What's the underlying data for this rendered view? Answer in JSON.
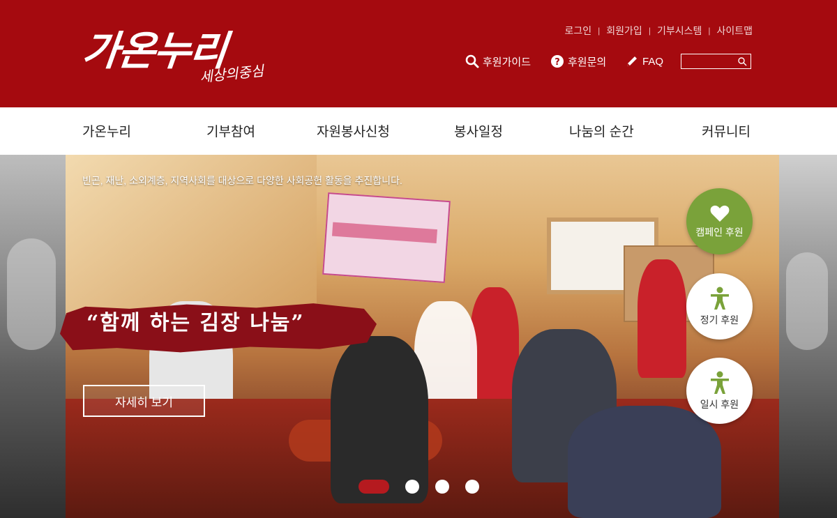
{
  "colors": {
    "header_bg": "#a50a0f",
    "accent_green": "#7aa23a",
    "dot_active": "#b51a1f"
  },
  "logo": {
    "main": "가온누리",
    "sub": "세상의중심"
  },
  "util_links": [
    "로그인",
    "회원가입",
    "기부시스템",
    "사이트맵"
  ],
  "quick_links": [
    {
      "label": "후원가이드",
      "icon": "search-icon"
    },
    {
      "label": "후원문의",
      "icon": "question-circle-icon"
    },
    {
      "label": "FAQ",
      "icon": "pencil-icon"
    }
  ],
  "search": {
    "placeholder": "",
    "icon": "search-icon"
  },
  "nav": [
    "가온누리",
    "기부참여",
    "자원봉사신청",
    "봉사일정",
    "나눔의 순간",
    "커뮤니티"
  ],
  "hero": {
    "tagline": "빈곤, 재난, 소외계층, 지역사회를 대상으로 다양한 사회공헌 활동을 추진합니다.",
    "headline": "“함께 하는 김장 나눔”",
    "more_button": "자세히 보기",
    "slide_count": 4,
    "active_slide": 1
  },
  "support_buttons": [
    {
      "label": "캠페인 후원",
      "icon": "heart-icon"
    },
    {
      "label": "정기 후원",
      "icon": "person-icon"
    },
    {
      "label": "일시 후원",
      "icon": "person-icon"
    }
  ]
}
